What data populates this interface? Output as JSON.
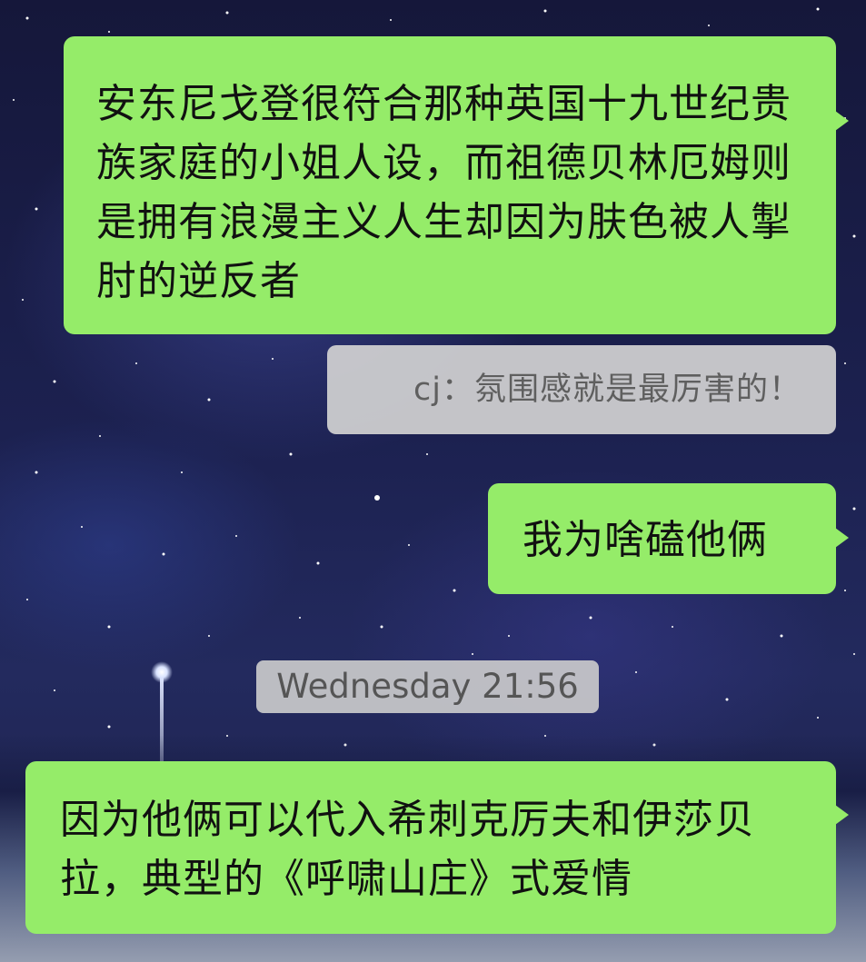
{
  "chat": {
    "messages": [
      {
        "sender": "me",
        "text": "安东尼戈登很符合那种英国十九世纪贵族家庭的小姐人设，而祖德贝林厄姆则是拥有浪漫主义人生却因为肤色被人掣肘的逆反者"
      },
      {
        "type": "quote",
        "text": "cj：氛围感就是最厉害的！"
      },
      {
        "sender": "me",
        "text": "我为啥磕他俩"
      },
      {
        "type": "timestamp",
        "text": "Wednesday 21:56"
      },
      {
        "sender": "me",
        "text": "因为他俩可以代入希刺克厉夫和伊莎贝拉，典型的《呼啸山庄》式爱情"
      }
    ]
  },
  "colors": {
    "bubble_green": "#95ec69",
    "quote_gray": "#d2d2d2",
    "timestamp_gray": "#cdcdcd"
  }
}
